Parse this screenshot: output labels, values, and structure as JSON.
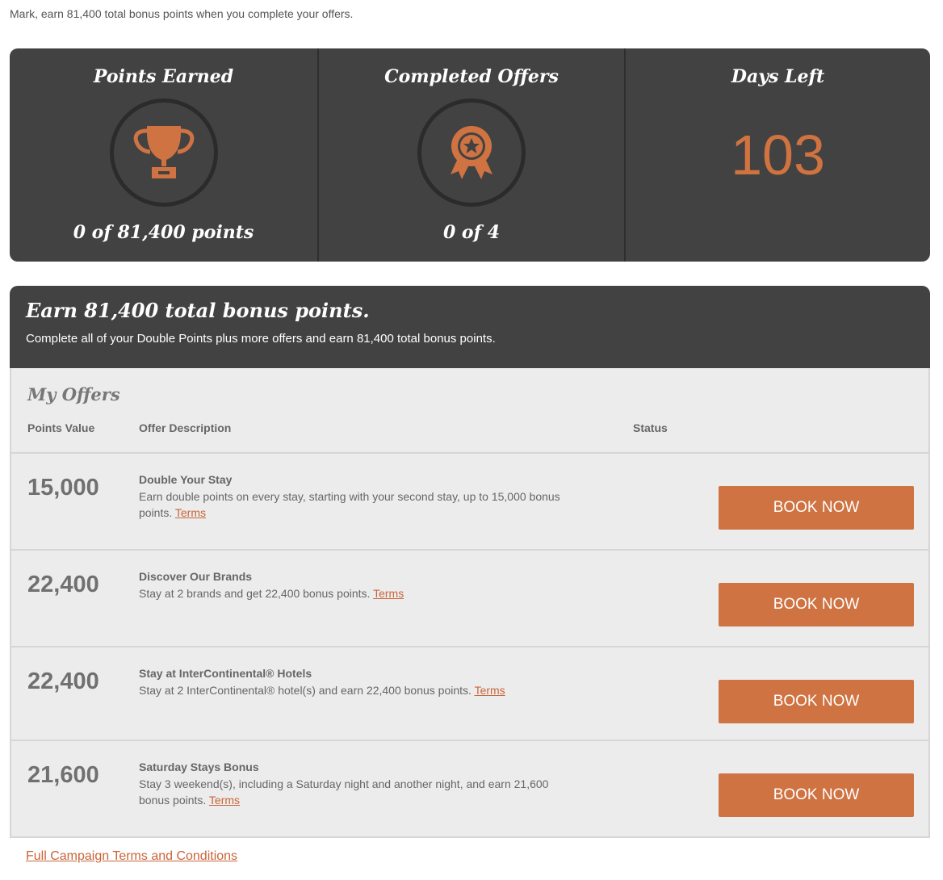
{
  "intro": "Mark, earn 81,400 total bonus points when you complete your offers.",
  "stats": {
    "points_title": "Points Earned",
    "points_foot": "0 of 81,400 points",
    "points_icon": "trophy-icon",
    "offers_title": "Completed Offers",
    "offers_foot": "0 of 4",
    "offers_icon": "award-ribbon-icon",
    "days_title": "Days Left",
    "days_value": "103"
  },
  "panel": {
    "title": "Earn 81,400 total bonus points.",
    "subtitle": "Complete all of your Double Points plus more offers and earn 81,400 total bonus points.",
    "my_offers": "My Offers",
    "columns": [
      "Points Value",
      "Offer Description",
      "Status"
    ]
  },
  "offers": [
    {
      "points": "15,000",
      "title": "Double Your Stay",
      "desc": "Earn double points on every stay, starting with your second stay, up to 15,000 bonus points. ",
      "terms": "Terms",
      "button": "BOOK NOW"
    },
    {
      "points": "22,400",
      "title": "Discover Our Brands",
      "desc": "Stay at 2 brands and get 22,400 bonus points. ",
      "terms": "Terms",
      "button": "BOOK NOW"
    },
    {
      "points": "22,400",
      "title": "Stay at InterContinental® Hotels",
      "desc": "Stay at 2 InterContinental® hotel(s) and earn 22,400 bonus points. ",
      "terms": "Terms",
      "button": "BOOK NOW"
    },
    {
      "points": "21,600",
      "title": "Saturday Stays Bonus",
      "desc": "Stay 3 weekend(s), including a Saturday night and another night, and earn 21,600 bonus points. ",
      "terms": "Terms",
      "button": "BOOK NOW"
    }
  ],
  "footer_link": "Full Campaign Terms and Conditions",
  "colors": {
    "accent": "#cf7342",
    "dark_panel": "#434242",
    "light_panel": "#ececec"
  }
}
